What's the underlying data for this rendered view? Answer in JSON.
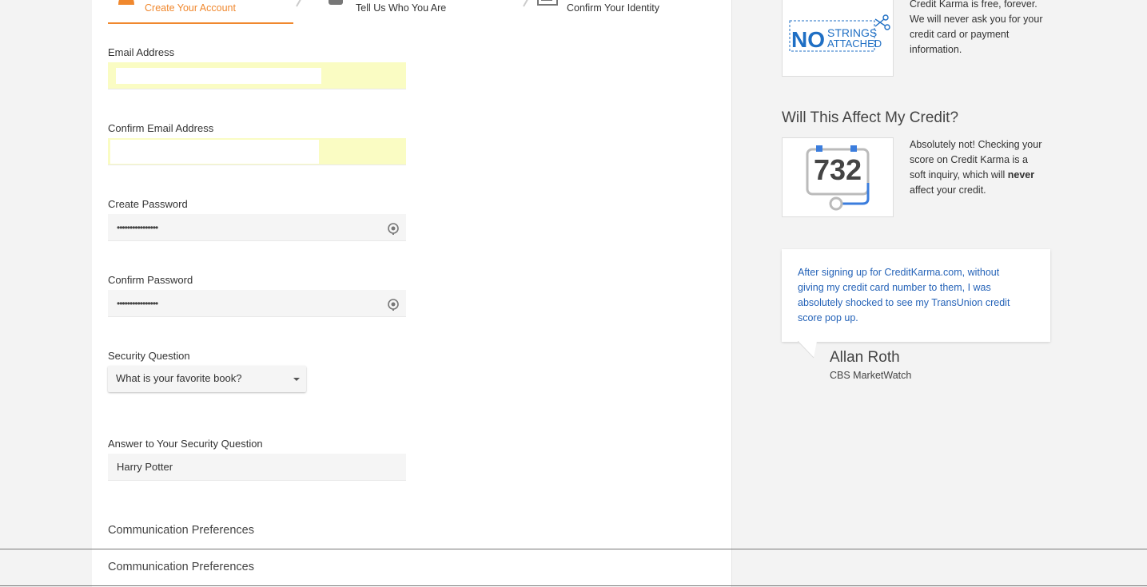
{
  "steps": [
    {
      "label": "Create Your Account"
    },
    {
      "label": "Tell Us Who You Are"
    },
    {
      "label": "Confirm Your Identity"
    }
  ],
  "form": {
    "email_label": "Email Address",
    "email_value": "",
    "confirm_email_label": "Confirm Email Address",
    "confirm_email_value": "",
    "password_label": "Create Password",
    "password_value": "••••••••••••••••",
    "confirm_password_label": "Confirm Password",
    "confirm_password_value": "••••••••••••••••",
    "security_question_label": "Security Question",
    "security_question_value": "What is your favorite book?",
    "answer_label": "Answer to Your Security Question",
    "answer_value": "Harry Potter",
    "communication_title": "Communication Preferences",
    "communication_title_sticky": "Communication Preferences"
  },
  "sidebar": {
    "free_text_line1": "Credit Karma is free, forever.",
    "free_text_line2": "We will never ask you for your",
    "free_text_line3": "credit card or payment",
    "free_text_line4": "information.",
    "no_strings_logo": {
      "word1": "NO",
      "word2": "STRINGS",
      "word3": "ATTACHED"
    },
    "affect_heading": "Will This Affect My Credit?",
    "score_value": "732",
    "affect_line1": "Absolutely not! Checking your",
    "affect_line2": "score on Credit Karma is a",
    "affect_line3a": "soft inquiry, which will ",
    "affect_line3b": "never",
    "affect_line4": "affect your credit.",
    "quote_line1": "After signing up for CreditKarma.com, without",
    "quote_line2": "giving my credit card number to them, I was",
    "quote_line3": "absolutely shocked to see my TransUnion credit",
    "quote_line4": "score pop up.",
    "author_name": "Allan Roth",
    "author_org": "CBS MarketWatch"
  },
  "colors": {
    "accent": "#f0882e",
    "quote_link": "#2563b8",
    "autofill": "#fafcc3",
    "logo_blue": "#1f6fc4"
  },
  "icons": {
    "step1": "user-icon",
    "step2": "id-card-icon",
    "step3": "document-icon",
    "password_toggle": "eye-icon",
    "select_caret": "chevron-down-icon"
  }
}
